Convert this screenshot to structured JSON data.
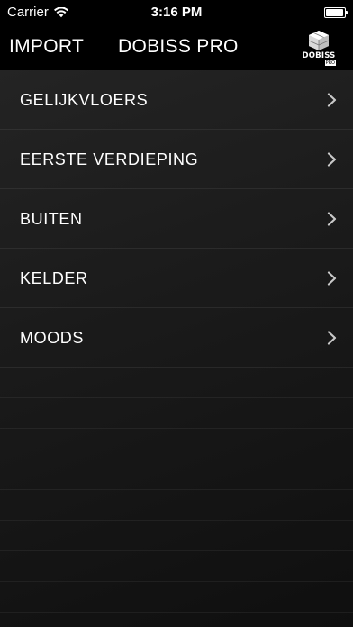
{
  "status_bar": {
    "carrier": "Carrier",
    "time": "3:16 PM",
    "wifi_icon": "wifi-icon",
    "battery_icon": "battery-icon"
  },
  "nav": {
    "left_button": "IMPORT",
    "title": "DOBISS PRO",
    "logo": {
      "icon": "dobiss-logo-icon",
      "text": "DOBISS",
      "sub": "PRO"
    }
  },
  "list": {
    "items": [
      {
        "label": "GELIJKVLOERS",
        "icon": "chevron-right-icon"
      },
      {
        "label": "EERSTE VERDIEPING",
        "icon": "chevron-right-icon"
      },
      {
        "label": "BUITEN",
        "icon": "chevron-right-icon"
      },
      {
        "label": "KELDER",
        "icon": "chevron-right-icon"
      },
      {
        "label": "MOODS",
        "icon": "chevron-right-icon"
      }
    ]
  }
}
